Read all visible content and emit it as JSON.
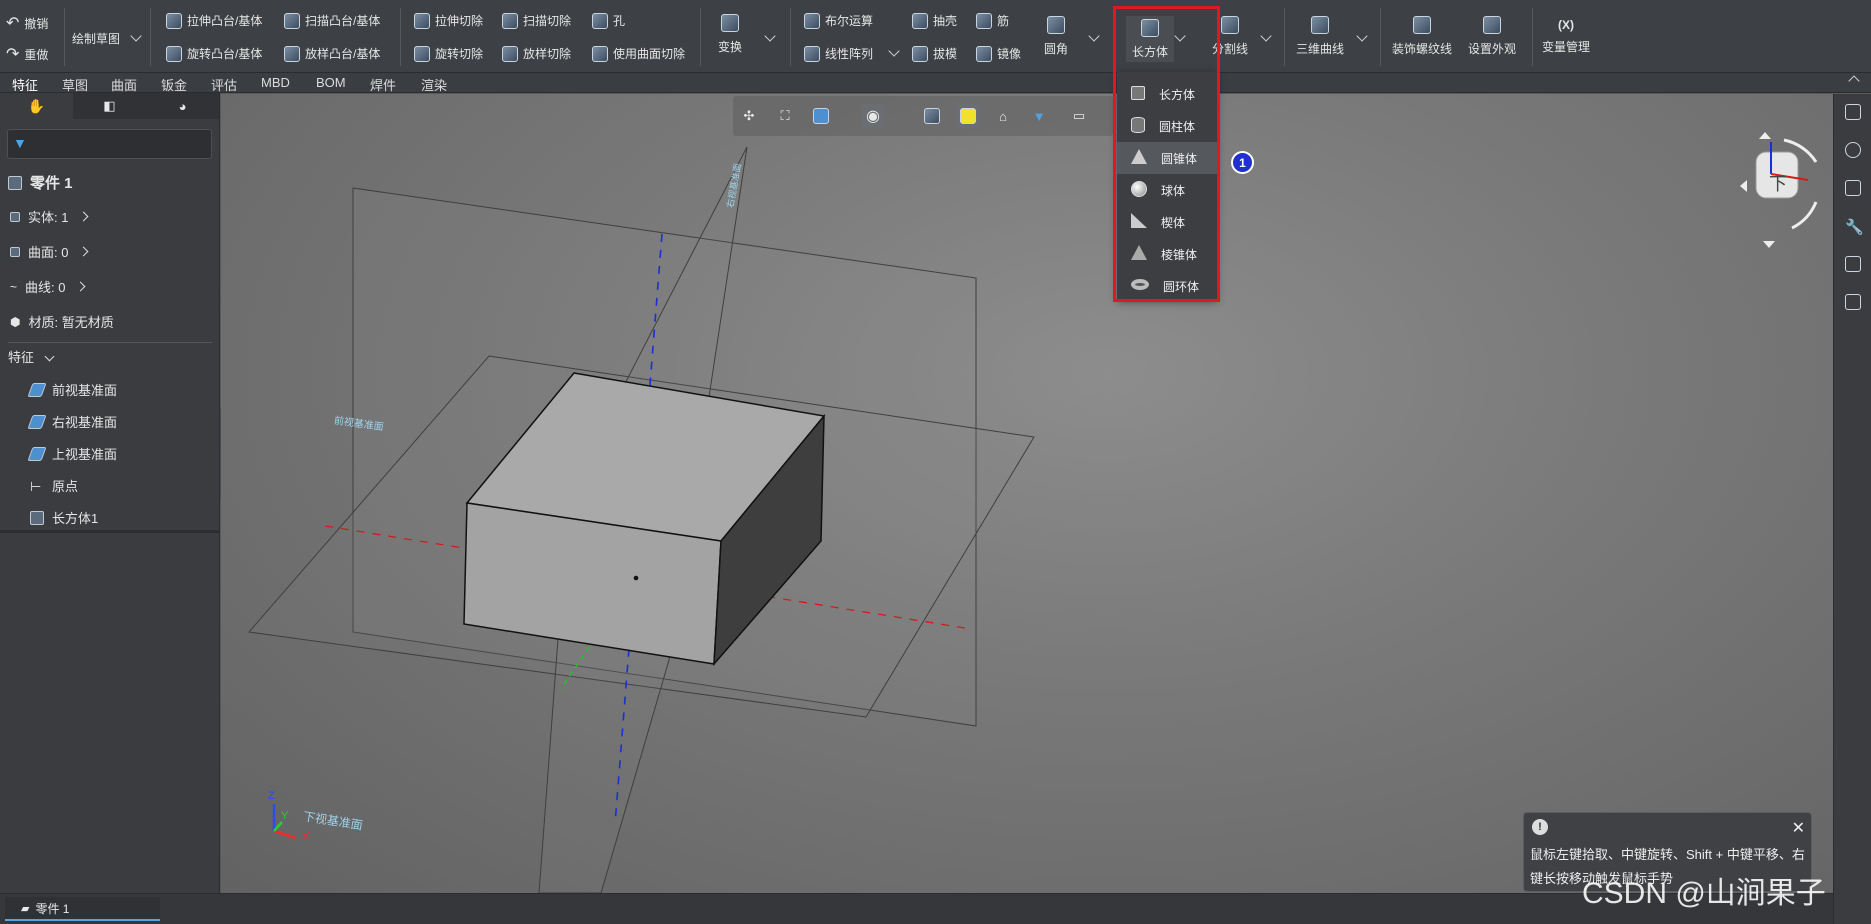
{
  "ribbon": {
    "undo": "撤销",
    "redo": "重做",
    "sketch": "绘制草图",
    "extrude_boss": "拉伸凸台/基体",
    "sweep_boss": "扫描凸台/基体",
    "revolve_boss": "旋转凸台/基体",
    "loft_boss": "放样凸台/基体",
    "extrude_cut": "拉伸切除",
    "sweep_cut": "扫描切除",
    "hole": "孔",
    "revolve_cut": "旋转切除",
    "loft_cut": "放样切除",
    "surface_cut": "使用曲面切除",
    "transform": "变换",
    "boolean": "布尔运算",
    "linear_pattern": "线性阵列",
    "shell": "抽壳",
    "rib": "筋",
    "draft": "拔模",
    "mirror": "镜像",
    "fillet": "圆角",
    "box": "长方体",
    "split_line": "分割线",
    "curve_3d": "三维曲线",
    "cosmetic_thread": "装饰螺纹线",
    "appearance": "设置外观",
    "var_icon": "(X)",
    "variables": "变量管理"
  },
  "tabs": [
    "特征",
    "草图",
    "曲面",
    "钣金",
    "评估",
    "MBD",
    "BOM",
    "焊件",
    "渲染"
  ],
  "sidebar": {
    "part_name": "零件 1",
    "solid": "实体: 1",
    "surface": "曲面: 0",
    "curve": "曲线: 0",
    "material": "材质: 暂无材质",
    "features_header": "特征",
    "features": [
      "前视基准面",
      "右视基准面",
      "上视基准面",
      "原点",
      "长方体1"
    ]
  },
  "dropdown": {
    "items": [
      {
        "label": "长方体",
        "icon": "box-icon"
      },
      {
        "label": "圆柱体",
        "icon": "cylinder-icon"
      },
      {
        "label": "圆锥体",
        "icon": "cone-icon"
      },
      {
        "label": "球体",
        "icon": "sphere-icon"
      },
      {
        "label": "楔体",
        "icon": "wedge-icon"
      },
      {
        "label": "棱锥体",
        "icon": "pyramid-icon"
      },
      {
        "label": "圆环体",
        "icon": "torus-icon"
      }
    ],
    "hovered_index": 2
  },
  "badge": "1",
  "viewport": {
    "plane_front": "前视基准面",
    "plane_bottom": "下视基准面",
    "plane_right": "右视基准面",
    "axis_z": "Z",
    "axis_y": "Y",
    "axis_x": "X",
    "cube_face": "下"
  },
  "tip": {
    "text": "鼠标左键拾取、中键旋转、Shift + 中键平移、右键长按移动触发鼠标手势"
  },
  "document_tab": "零件 1",
  "watermark": "CSDN @山涧果子",
  "colors": {
    "highlight": "#e0191f",
    "badge": "#1f2fd1",
    "accent": "#5aa3e0"
  }
}
